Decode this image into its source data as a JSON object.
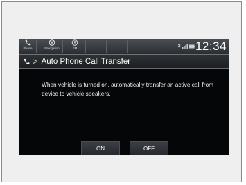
{
  "statusbar": {
    "apps": [
      {
        "label": "Phone",
        "icon": "phone-icon"
      },
      {
        "label": "Navigation",
        "icon": "navigation-icon"
      },
      {
        "label": "FM",
        "icon": "radio-icon"
      }
    ],
    "clock": "12:34",
    "indicators": [
      "bluetooth-icon",
      "signal-icon",
      "battery-icon"
    ]
  },
  "titlebar": {
    "icon": "phone-icon",
    "separator": ">",
    "title": "Auto Phone Call Transfer"
  },
  "description": "When vehicle is turned on, automatically transfer an active call from device to vehicle speakers.",
  "buttons": {
    "on_label": "ON",
    "off_label": "OFF"
  },
  "colors": {
    "screen_background": "#050607",
    "text": "#ffffff",
    "bar": "#2e3236"
  }
}
